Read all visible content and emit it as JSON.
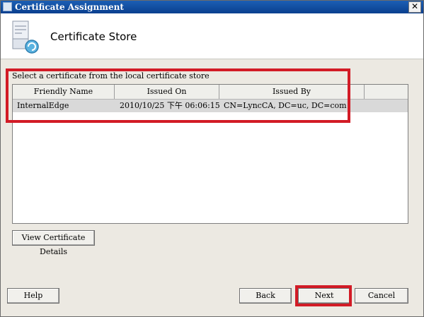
{
  "window": {
    "title": "Certificate Assignment",
    "close_glyph": "✕"
  },
  "header": {
    "title": "Certificate Store",
    "icon": "certificate-store-icon"
  },
  "instruction": "Select a certificate from the local certificate store",
  "table": {
    "columns": [
      "Friendly Name",
      "Issued On",
      "Issued By",
      ""
    ],
    "rows": [
      {
        "friendly_name": "InternalEdge",
        "issued_on": "2010/10/25 下午 06:06:15",
        "issued_by": "CN=LyncCA, DC=uc, DC=com"
      }
    ]
  },
  "buttons": {
    "view_details": "View Certificate Details",
    "help": "Help",
    "back": "Back",
    "next": "Next",
    "cancel": "Cancel"
  },
  "colors": {
    "title_bar": "#0a3f8f",
    "highlight": "#d21b26",
    "selected_row": "#d9d9d9"
  }
}
